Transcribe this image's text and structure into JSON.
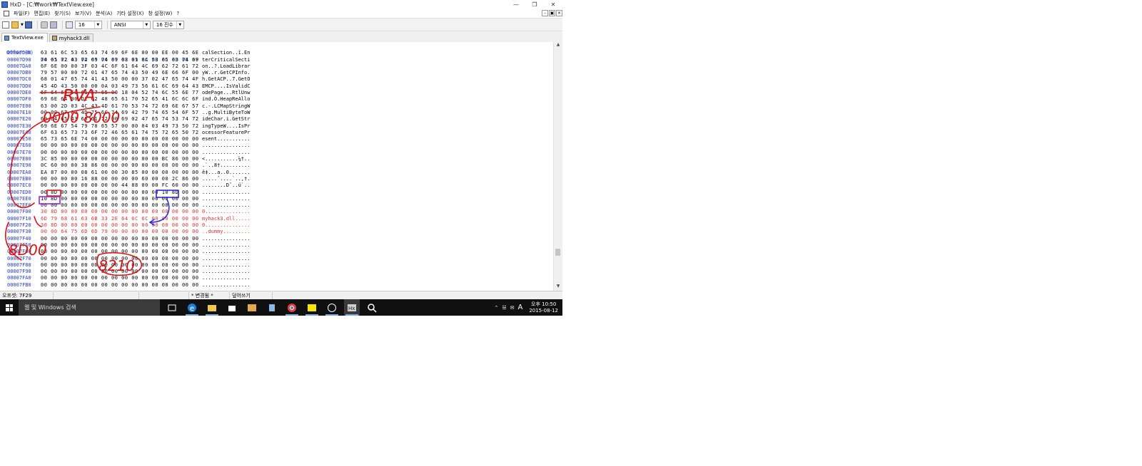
{
  "window": {
    "title": "HxD - [C:₩work₩TextView.exe]"
  },
  "menu": [
    "파일(F)",
    "편집(E)",
    "찾기(S)",
    "보기(V)",
    "분석(A)",
    "기타 설정(X)",
    "창 설정(W)",
    "?"
  ],
  "toolbar": {
    "bytes_per_row": "16",
    "charset": "ANSI",
    "offset_base": "16 진수"
  },
  "tabs": [
    {
      "label": "TextView.exe",
      "active": true
    },
    {
      "label": "myhack3.dll",
      "active": false
    }
  ],
  "hex_view": {
    "header_offset": "Offset(h)",
    "header_columns": "00 01 02 03 04 05 06 07 08 09 0A 0B 0C 0D 0E 0F",
    "rows": [
      {
        "offset": "00007D80",
        "hex": "63 61 6C 53 65 63 74 69 6F 6E 00 00 EE 00 45 6E",
        "ascii": "calSection..î.En",
        "red": false
      },
      {
        "offset": "00007D90",
        "hex": "74 65 72 43 72 69 74 69 63 61 6C 53 65 63 74 69",
        "ascii": "terCriticalSecti",
        "red": false
      },
      {
        "offset": "00007DA0",
        "hex": "6F 6E 00 00 3F 03 4C 6F 61 64 4C 69 62 72 61 72",
        "ascii": "on..?.LoadLibrar",
        "red": false
      },
      {
        "offset": "00007DB0",
        "hex": "79 57 00 00 72 01 47 65 74 43 50 49 6E 66 6F 00",
        "ascii": "yW..r.GetCPInfo.",
        "red": false
      },
      {
        "offset": "00007DC0",
        "hex": "68 01 47 65 74 41 43 50 00 00 37 02 47 65 74 4F",
        "ascii": "h.GetACP..7.GetO",
        "red": false
      },
      {
        "offset": "00007DD0",
        "hex": "45 4D 43 50 00 00 0A 03 49 73 56 61 6C 69 64 43",
        "ascii": "EMCP....IsValidC",
        "red": false
      },
      {
        "offset": "00007DE0",
        "hex": "6F 64 65 50 61 67 65 00 18 04 52 74 6C 55 6E 77",
        "ascii": "odePage...RtlUnw",
        "red": false
      },
      {
        "offset": "00007DF0",
        "hex": "69 6E 64 00 D2 02 48 65 61 70 52 65 41 6C 6C 6F",
        "ascii": "ind.Ò.HeapReAllo",
        "red": false
      },
      {
        "offset": "00007E00",
        "hex": "63 00 2D 03 4C 43 4D 61 70 53 74 72 69 6E 67 57",
        "ascii": "c.-.LCMapStringW",
        "red": false
      },
      {
        "offset": "00007E10",
        "hex": "00 00 67 03 4D 75 6C 74 69 42 79 74 65 54 6F 57",
        "ascii": "..g.MultiByteToW",
        "red": false
      },
      {
        "offset": "00007E20",
        "hex": "69 64 65 43 68 61 72 00 69 02 47 65 74 53 74 72",
        "ascii": "ideChar.i.GetStr",
        "red": false
      },
      {
        "offset": "00007E30",
        "hex": "69 6E 67 54 79 70 65 57 00 00 04 03 49 73 50 72",
        "ascii": "ingTypeW....IsPr",
        "red": false
      },
      {
        "offset": "00007E40",
        "hex": "6F 63 65 73 73 6F 72 46 65 61 74 75 72 65 50 72",
        "ascii": "ocessorFeaturePr",
        "red": false
      },
      {
        "offset": "00007E50",
        "hex": "65 73 65 6E 74 00 00 00 00 00 00 00 00 00 00 00",
        "ascii": "esent...........",
        "red": false
      },
      {
        "offset": "00007E60",
        "hex": "00 00 00 00 00 00 00 00 00 00 00 00 00 00 00 00",
        "ascii": "................",
        "red": false
      },
      {
        "offset": "00007E70",
        "hex": "00 00 00 00 00 00 00 00 00 00 00 00 00 00 00 00",
        "ascii": "................",
        "red": false
      },
      {
        "offset": "00007E80",
        "hex": "3C 85 00 00 00 00 00 00 00 00 00 00 BC 86 00 00",
        "ascii": "<...........¼†..",
        "red": false
      },
      {
        "offset": "00007E90",
        "hex": "0C 60 00 00 38 86 00 00 00 00 00 00 00 00 00 00",
        "ascii": ".`..8†..........",
        "red": false
      },
      {
        "offset": "00007EA0",
        "hex": "EA 87 00 00 08 61 00 00 30 85 00 00 00 00 00 00",
        "ascii": "ê‡...a..0.......",
        "red": false
      },
      {
        "offset": "00007EB0",
        "hex": "00 00 00 00 16 88 00 00 00 00 60 00 00 2C 86 00",
        "ascii": ".....ˆ....`..,†.",
        "red": false
      },
      {
        "offset": "00007EC0",
        "hex": "00 00 00 00 00 00 00 00 44 88 00 00 FC 60 00 00",
        "ascii": "........Dˆ..ü`..",
        "red": false
      },
      {
        "offset": "00007ED0",
        "hex": "00 8D 00 00 00 00 00 00 00 00 00 00 10 8D 00 00",
        "ascii": "................",
        "red": false
      },
      {
        "offset": "00007EE0",
        "hex": "10 8D 00 00 00 00 00 00 00 00 00 00 00 00 00 00",
        "ascii": "................",
        "red": false
      },
      {
        "offset": "00007EF0",
        "hex": "00 00 00 00 00 00 00 00 00 00 00 00 00 00 00 00",
        "ascii": "................",
        "red": false
      },
      {
        "offset": "00007F00",
        "hex": "30 8D 00 00 00 00 00 00 00 00 00 00 00 00 00 00",
        "ascii": "0...............",
        "red": true
      },
      {
        "offset": "00007F10",
        "hex": "6D 79 68 61 63 6B 33 2E 64 6C 6C 00 00 00 00 00",
        "ascii": "myhack3.dll.....",
        "red": true
      },
      {
        "offset": "00007F20",
        "hex": "30 8D 00 00 00 00 00 00 00 00 00 00 00 00 00 00",
        "ascii": "0...............",
        "red": true
      },
      {
        "offset": "00007F30",
        "hex": "00 00 64 75 6D 6D 79 00 00 00 00 00 00 00 00 00",
        "ascii": "..dummy.........",
        "red": true
      },
      {
        "offset": "00007F40",
        "hex": "00 00 00 00 00 00 00 00 00 00 00 00 00 00 00 00",
        "ascii": "................",
        "red": false
      },
      {
        "offset": "00007F50",
        "hex": "00 00 00 00 00 00 00 00 00 00 00 00 00 00 00 00",
        "ascii": "................",
        "red": false
      },
      {
        "offset": "00007F60",
        "hex": "00 00 00 00 00 00 00 00 00 00 00 00 00 00 00 00",
        "ascii": "................",
        "red": false
      },
      {
        "offset": "00007F70",
        "hex": "00 00 00 00 00 00 00 00 00 00 00 00 00 00 00 00",
        "ascii": "................",
        "red": false
      },
      {
        "offset": "00007F80",
        "hex": "00 00 00 00 00 00 00 00 00 00 00 00 00 00 00 00",
        "ascii": "................",
        "red": false
      },
      {
        "offset": "00007F90",
        "hex": "00 00 00 00 00 00 00 00 00 00 00 00 00 00 00 00",
        "ascii": "................",
        "red": false
      },
      {
        "offset": "00007FA0",
        "hex": "00 00 00 00 00 00 00 00 00 00 00 00 00 00 00 00",
        "ascii": "................",
        "red": false
      },
      {
        "offset": "00007FB0",
        "hex": "00 00 00 00 00 00 00 00 00 00 00 00 00 00 00 00",
        "ascii": "................",
        "red": false
      }
    ]
  },
  "annotations": {
    "rva_label": "RVA",
    "rva_value": "0000 8000",
    "rva_left_value": "8D00",
    "bottom_value": "8210",
    "annotation_color": "#e01010",
    "box_blue": "#2b2bd8",
    "box_red": "#d81a1a",
    "box_purple": "#9a2bd8"
  },
  "status": {
    "offset_label": "오프셋: 7F29",
    "modified": "* 변경됨 *",
    "mode": "덮어쓰기"
  },
  "taskbar": {
    "search_placeholder": "웹 및 Windows 검색",
    "clock_period_time": "오후 10:50",
    "clock_date": "2015-08-12",
    "ime": "A"
  }
}
